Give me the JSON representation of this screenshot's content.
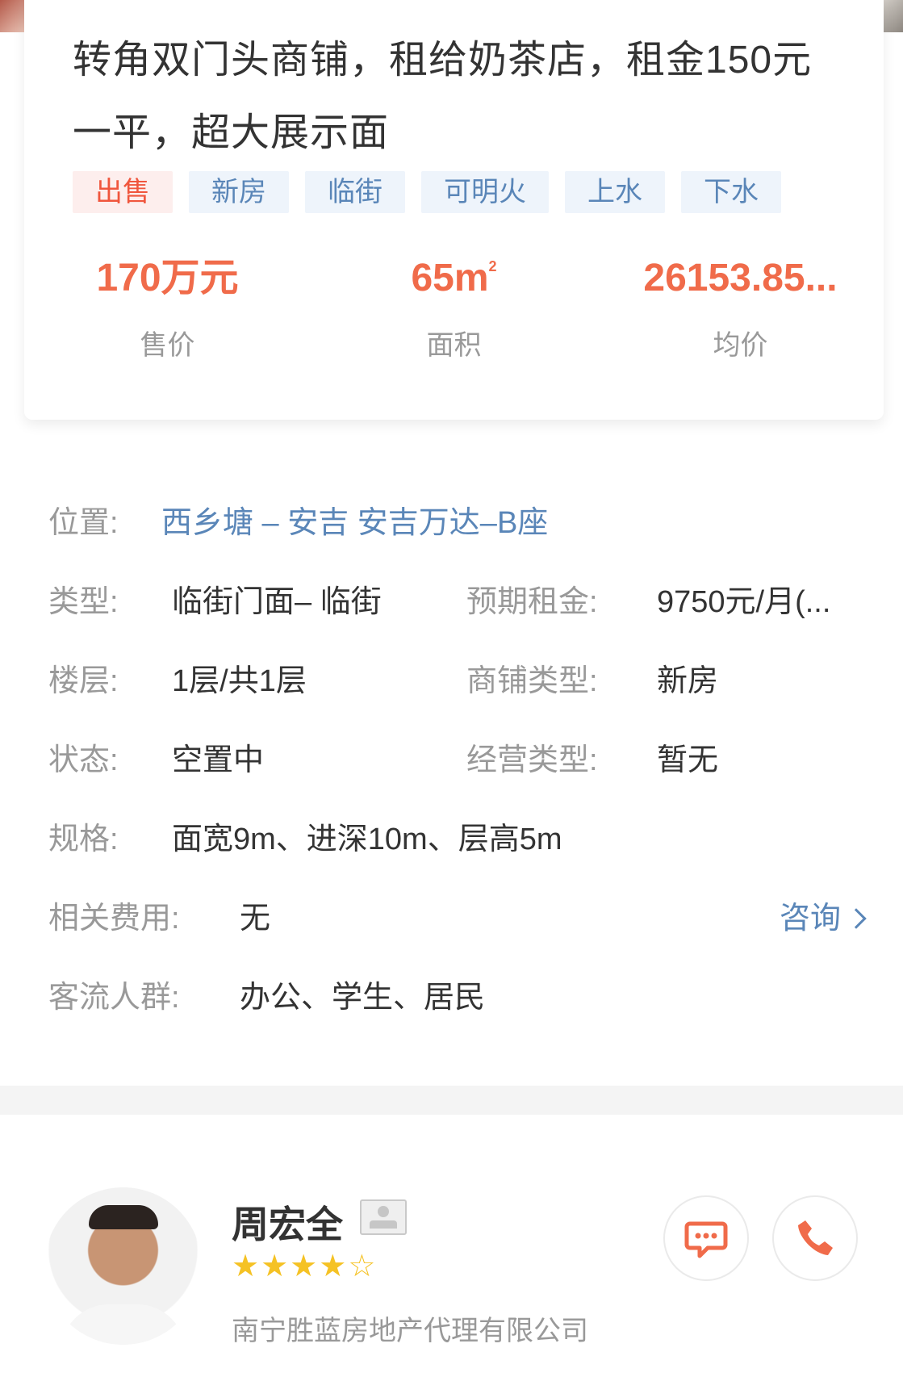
{
  "listing": {
    "title": "转角双门头商铺，租给奶茶店，租金150元一平，超大展示面",
    "tags": [
      "出售",
      "新房",
      "临街",
      "可明火",
      "上水",
      "下水"
    ],
    "stats": [
      {
        "value": "170万元",
        "label": "售价"
      },
      {
        "value": "65m",
        "sup": "2",
        "label": "面积"
      },
      {
        "value": "26153.85...",
        "label": "均价"
      }
    ]
  },
  "details": {
    "location_label": "位置:",
    "location_value": "西乡塘 – 安吉 安吉万达–B座",
    "type_label": "类型:",
    "type_value": "临街门面– 临街",
    "rent_label": "预期租金:",
    "rent_value": "9750元/月(...",
    "floor_label": "楼层:",
    "floor_value": "1层/共1层",
    "shop_type_label": "商铺类型:",
    "shop_type_value": "新房",
    "status_label": "状态:",
    "status_value": "空置中",
    "business_label": "经营类型:",
    "business_value": "暂无",
    "spec_label": "规格:",
    "spec_value": "面宽9m、进深10m、层高5m",
    "fees_label": "相关费用:",
    "fees_value": "无",
    "consult_label": "咨询",
    "traffic_label": "客流人群:",
    "traffic_value": "办公、学生、居民"
  },
  "agent": {
    "name": "周宏全",
    "rating": 4,
    "rating_max": 5,
    "company": "南宁胜蓝房地产代理有限公司"
  },
  "colors": {
    "accent_red": "#f06b4a",
    "link_blue": "#5a86b8",
    "star": "#f5c224"
  }
}
